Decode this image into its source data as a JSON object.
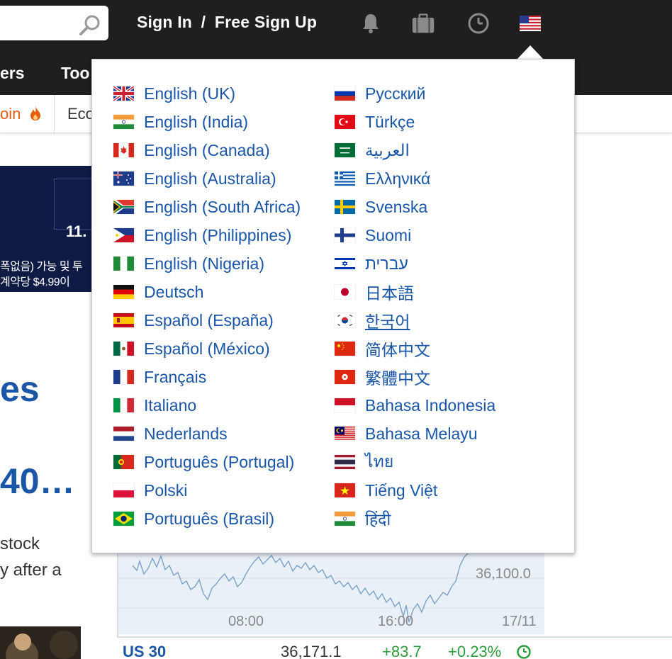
{
  "header": {
    "search_placeholder": "",
    "sign_in": "Sign In",
    "separator": "/",
    "sign_up": "Free Sign Up",
    "icons": [
      "search-icon",
      "bell-icon",
      "briefcase-icon",
      "clock-icon",
      "us-flag-icon"
    ]
  },
  "nav": {
    "item1": "ers",
    "item2": "Too"
  },
  "subnav": {
    "item1": "oin",
    "item2": "Eco"
  },
  "banner": {
    "number": "11.",
    "line1": "폭없음) 가능 및 투",
    "line2": "계약당 $4.99이"
  },
  "article": {
    "headline1": "es",
    "headline2": "40…",
    "line1": "stock",
    "line2": "y after a"
  },
  "chart_widget": {
    "y_label": "36,100.0",
    "x_labels": [
      "08:00",
      "16:00",
      "17/11"
    ]
  },
  "chart_data": {
    "type": "line",
    "x_ticks": [
      "08:00",
      "16:00",
      "17/11"
    ],
    "y_ticks": [
      "36,100.0"
    ]
  },
  "quote": {
    "name": "US 30",
    "price": "36,171.1",
    "change": "+83.7",
    "change_pct": "+0.23%",
    "up_color": "#2a9d3a"
  },
  "languages": {
    "left": [
      {
        "name": "English (UK)",
        "flag": "uk"
      },
      {
        "name": "English (India)",
        "flag": "in"
      },
      {
        "name": "English (Canada)",
        "flag": "ca"
      },
      {
        "name": "English (Australia)",
        "flag": "au"
      },
      {
        "name": "English (South Africa)",
        "flag": "za"
      },
      {
        "name": "English (Philippines)",
        "flag": "ph"
      },
      {
        "name": "English (Nigeria)",
        "flag": "ng"
      },
      {
        "name": "Deutsch",
        "flag": "de"
      },
      {
        "name": "Español (España)",
        "flag": "es"
      },
      {
        "name": "Español (México)",
        "flag": "mx"
      },
      {
        "name": "Français",
        "flag": "fr"
      },
      {
        "name": "Italiano",
        "flag": "it"
      },
      {
        "name": "Nederlands",
        "flag": "nl"
      },
      {
        "name": "Português (Portugal)",
        "flag": "pt"
      },
      {
        "name": "Polski",
        "flag": "pl"
      },
      {
        "name": "Português (Brasil)",
        "flag": "br"
      }
    ],
    "right": [
      {
        "name": "Русский",
        "flag": "ru"
      },
      {
        "name": "Türkçe",
        "flag": "tr"
      },
      {
        "name": "العربية",
        "flag": "sa"
      },
      {
        "name": "Ελληνικά",
        "flag": "gr"
      },
      {
        "name": "Svenska",
        "flag": "se"
      },
      {
        "name": "Suomi",
        "flag": "fi"
      },
      {
        "name": "עברית",
        "flag": "il"
      },
      {
        "name": "日本語",
        "flag": "jp"
      },
      {
        "name": "한국어",
        "flag": "kr",
        "hovered": true
      },
      {
        "name": "简体中文",
        "flag": "cn"
      },
      {
        "name": "繁體中文",
        "flag": "hk"
      },
      {
        "name": "Bahasa Indonesia",
        "flag": "id"
      },
      {
        "name": "Bahasa Melayu",
        "flag": "my"
      },
      {
        "name": "ไทย",
        "flag": "th"
      },
      {
        "name": "Tiếng Việt",
        "flag": "vn"
      },
      {
        "name": "हिंदी",
        "flag": "in"
      }
    ]
  },
  "colors": {
    "link_blue": "#1a56a8",
    "header_bg": "#1f1f1f",
    "accent_orange": "#e85c0d"
  }
}
